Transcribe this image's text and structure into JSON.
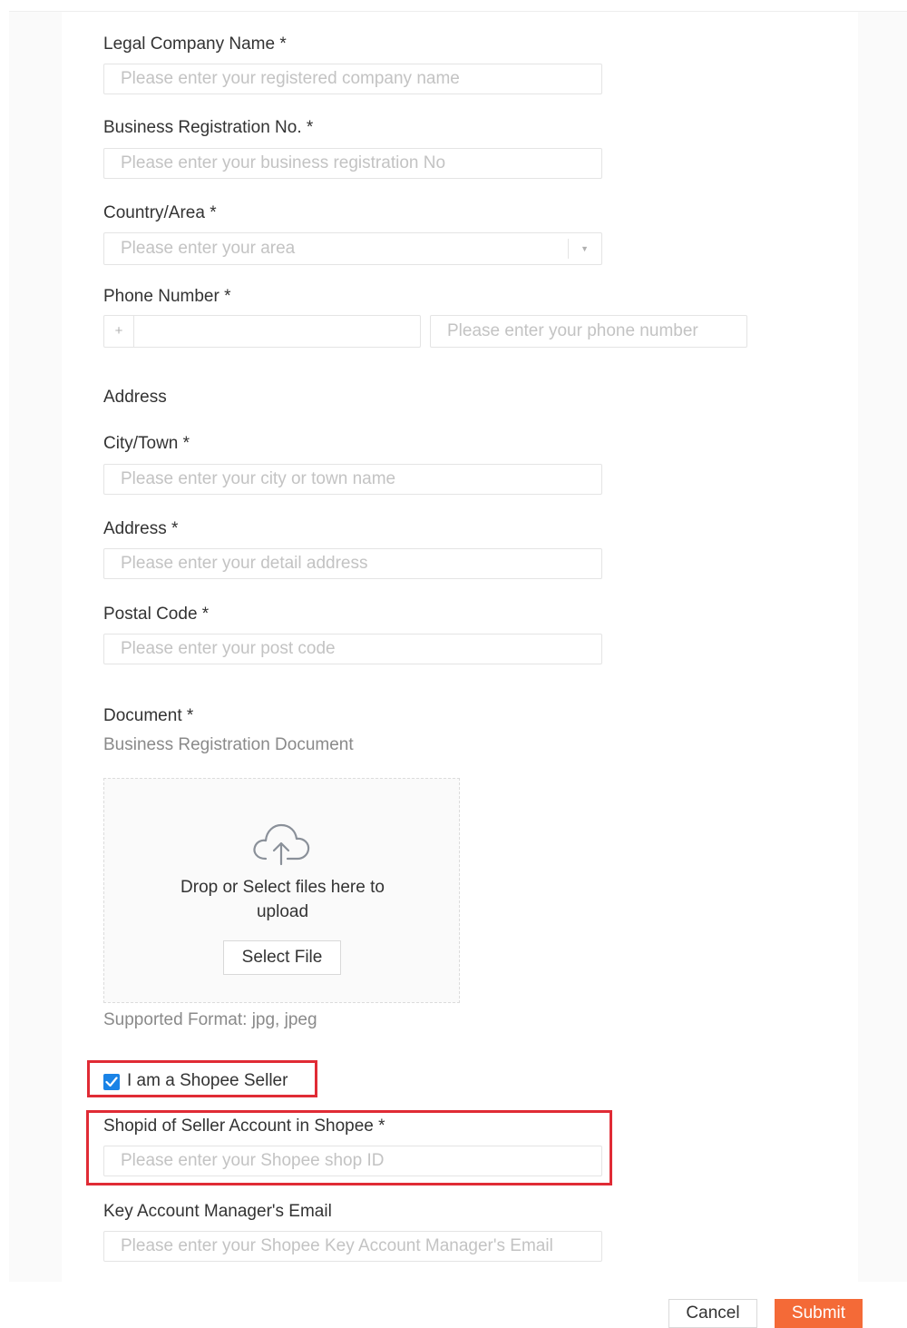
{
  "form": {
    "legal_company_name": {
      "label": "Legal Company Name *",
      "placeholder": "Please enter your registered company name",
      "value": ""
    },
    "business_registration_no": {
      "label": "Business Registration No. *",
      "placeholder": "Please enter your business registration No",
      "value": ""
    },
    "country_area": {
      "label": "Country/Area *",
      "placeholder": "Please enter your area"
    },
    "phone_number": {
      "label": "Phone Number *",
      "code_prefix": "+",
      "placeholder": "Please enter your phone number",
      "value": ""
    },
    "address_section_title": "Address",
    "city_town": {
      "label": "City/Town *",
      "placeholder": "Please enter your city or town name",
      "value": ""
    },
    "address": {
      "label": "Address *",
      "placeholder": "Please enter your detail address",
      "value": ""
    },
    "postal_code": {
      "label": "Postal Code *",
      "placeholder": "Please enter your post code",
      "value": ""
    },
    "document": {
      "label": "Document *",
      "sublabel": "Business Registration Document",
      "upload_message": "Drop or Select files here to upload",
      "select_button": "Select File",
      "supported_format": "Supported Format: jpg, jpeg",
      "icon": "cloud-upload-icon"
    },
    "shopee_seller": {
      "label": "I am a Shopee Seller",
      "checked": true
    },
    "shop_id": {
      "label": "Shopid of Seller Account in Shopee *",
      "placeholder": "Please enter your Shopee shop ID",
      "value": ""
    },
    "kam_email": {
      "label": "Key Account Manager's Email",
      "placeholder": "Please enter your Shopee Key Account Manager's Email",
      "value": ""
    }
  },
  "footer": {
    "cancel_label": "Cancel",
    "submit_label": "Submit"
  },
  "colors": {
    "accent": "#f46a37",
    "checkbox": "#1a83e6",
    "highlight": "#e02b35"
  }
}
